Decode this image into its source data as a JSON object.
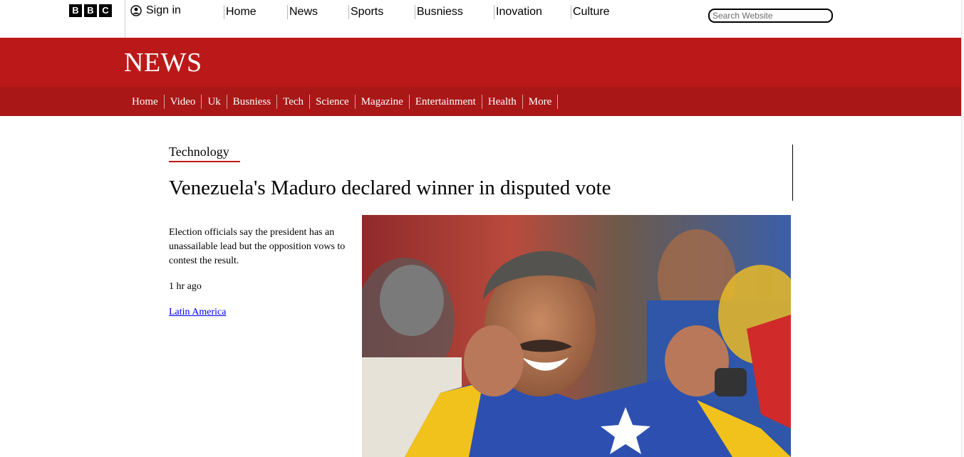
{
  "brand": {
    "letters": [
      "B",
      "B",
      "C"
    ]
  },
  "header": {
    "signin_label": "Sign in",
    "nav": [
      "Home",
      "News",
      "Sports",
      "Busniess",
      "Inovation",
      "Culture"
    ],
    "search_placeholder": "Search Website"
  },
  "news_band": {
    "title": "NEWS",
    "subnav": [
      "Home",
      "Video",
      "Uk",
      "Busniess",
      "Tech",
      "Science",
      "Magazine",
      "Entertainment",
      "Health",
      "More"
    ]
  },
  "article": {
    "section": "Technology",
    "headline": "Venezuela's Maduro declared winner in disputed vote",
    "summary": "Election officials say the president has an unassailable lead but the opposition vows to contest the result.",
    "time": "1 hr ago",
    "topic": "Latin America",
    "image_alt": ""
  },
  "colors": {
    "brand_red": "#bb1919",
    "subnav_red": "#a91717",
    "link": "#0000ee"
  },
  "icons": {
    "signin": "user-circle-icon"
  }
}
